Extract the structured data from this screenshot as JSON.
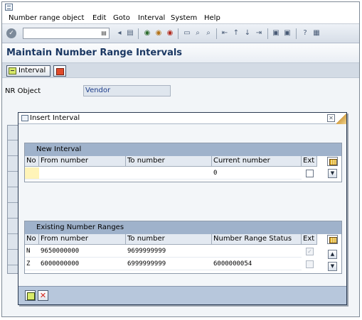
{
  "menu": [
    "Number range object",
    "Edit",
    "Goto",
    "Interval",
    "System",
    "Help"
  ],
  "toolbar": {
    "icons": [
      "save-icon",
      "back-icon",
      "exit-icon",
      "cancel-icon",
      "print-icon",
      "find-icon",
      "find-next-icon",
      "first-page-icon",
      "previous-page-icon",
      "next-page-icon",
      "last-page-icon",
      "create-session-icon",
      "shortcut-icon",
      "help-icon",
      "layout-icon"
    ]
  },
  "page": {
    "title": "Maintain Number Range Intervals"
  },
  "app_toolbar": {
    "interval_label": "Interval"
  },
  "nr_object": {
    "label": "NR Object",
    "value": "Vendor"
  },
  "dialog": {
    "title": "Insert Interval",
    "new_interval": {
      "heading": "New Interval",
      "columns": [
        "No",
        "From number",
        "To number",
        "Current number",
        "Ext"
      ],
      "row": {
        "no": "",
        "from": "",
        "to": "",
        "current": "0",
        "ext": false
      }
    },
    "existing": {
      "heading": "Existing Number Ranges",
      "columns": [
        "No",
        "From number",
        "To number",
        "Number Range Status",
        "Ext"
      ],
      "rows": [
        {
          "no": "N",
          "from": "9650000000",
          "to": "9699999999",
          "status": "",
          "ext": true
        },
        {
          "no": "Z",
          "from": "6000000000",
          "to": "6999999999",
          "status": "6000000054",
          "ext": false
        }
      ]
    }
  },
  "colors": {
    "brand": "#1b3863",
    "section_header": "#9fb2cb",
    "footer": "#b7c7dc",
    "input_highlight": "#fff4b8"
  }
}
